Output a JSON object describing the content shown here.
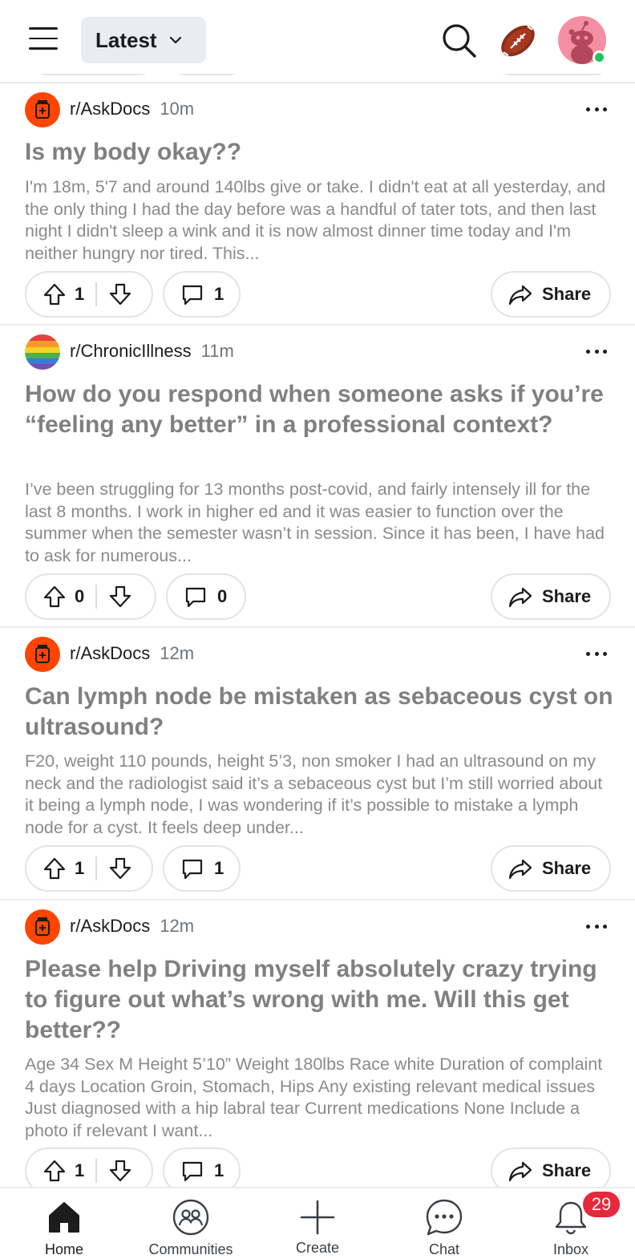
{
  "header": {
    "sort_label": "Latest",
    "menu_icon": "hamburger-icon",
    "search_icon": "search-icon",
    "football_icon": "football-icon",
    "avatar_icon": "snoo-avatar"
  },
  "posts": [
    {
      "subreddit": "r/AskDocs",
      "time": "10m",
      "title": "Is my body okay??",
      "body": "I'm 18m, 5'7 and around 140lbs give or take. I didn't eat at all yesterday, and the only thing I had the day before was a handful of tater tots, and then last night I didn't sleep a wink and it is now almost dinner time today and I'm neither hungry nor tired. This...",
      "votes": "1",
      "comments": "1",
      "share_label": "Share"
    },
    {
      "subreddit": "r/ChronicIllness",
      "time": "11m",
      "title": "How do you respond when someone asks if you’re “feeling any better” in a professional context?",
      "body": "I’ve been struggling for 13 months post-covid, and fairly intensely ill for the last 8 months. I work in higher ed and it was easier to function over the summer when the semester wasn’t in session. Since it has been, I have had to ask for numerous...",
      "votes": "0",
      "comments": "0",
      "share_label": "Share"
    },
    {
      "subreddit": "r/AskDocs",
      "time": "12m",
      "title": "Can lymph node be mistaken as sebaceous cyst on ultrasound?",
      "body": "F20, weight 110 pounds, height 5’3, non smoker I had an ultrasound on my neck and the radiologist said it’s a sebaceous cyst but I’m still worried about it being a lymph node, I was wondering if it’s possible to mistake a lymph node for a cyst. It feels deep under...",
      "votes": "1",
      "comments": "1",
      "share_label": "Share"
    },
    {
      "subreddit": "r/AskDocs",
      "time": "12m",
      "title": "Please help Driving myself absolutely crazy trying to figure out what’s wrong with me. Will this get better??",
      "body": "Age 34 Sex M Height 5’10” Weight 180lbs Race white Duration of complaint 4 days Location Groin, Stomach, Hips Any existing relevant medical issues Just diagnosed with a hip labral tear Current medications None Include a photo if relevant I want...",
      "votes": "1",
      "comments": "1",
      "share_label": "Share"
    }
  ],
  "nav": {
    "home": "Home",
    "communities": "Communities",
    "create": "Create",
    "chat": "Chat",
    "inbox": "Inbox",
    "inbox_badge": "29"
  },
  "colors": {
    "askdocs_icon": "#ff4500",
    "badge": "#e8283b",
    "online": "#24c161",
    "read_title": "#808080"
  }
}
